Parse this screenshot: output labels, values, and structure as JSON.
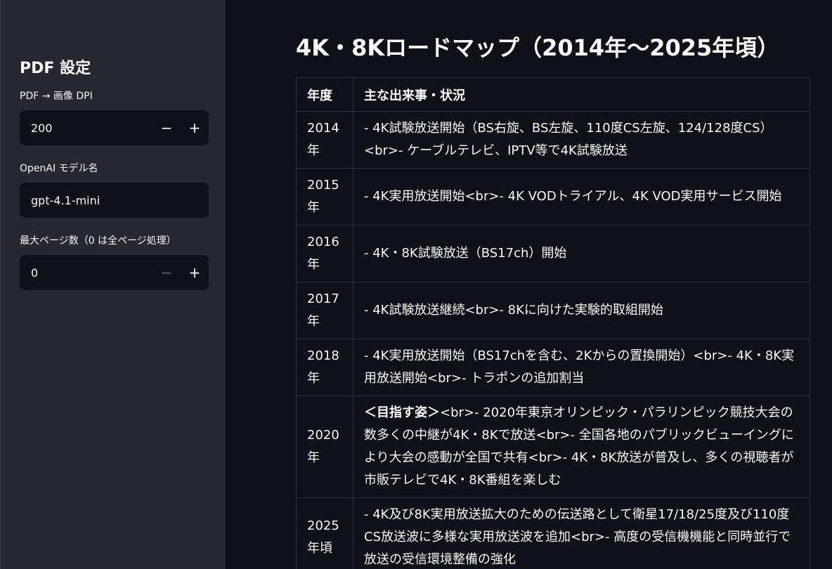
{
  "sidebar": {
    "title": "PDF 設定",
    "dpi": {
      "label": "PDF → 画像 DPI",
      "value": "200",
      "minus": "−",
      "plus": "+"
    },
    "model": {
      "label": "OpenAI モデル名",
      "value": "gpt-4.1-mini"
    },
    "max_pages": {
      "label": "最大ページ数（0 は全ページ処理）",
      "value": "0",
      "minus": "−",
      "plus": "+"
    }
  },
  "main": {
    "title": "4K・8Kロードマップ（2014年〜2025年頃）",
    "table": {
      "headers": [
        "年度",
        "主な出来事・状況"
      ],
      "rows": [
        {
          "year": "2014年",
          "event": "- 4K試験放送開始（BS右旋、BS左旋、110度CS左旋、124/128度CS）<br>- ケーブルテレビ、IPTV等で4K試験放送"
        },
        {
          "year": "2015年",
          "event": "- 4K実用放送開始<br>- 4K VODトライアル、4K VOD実用サービス開始"
        },
        {
          "year": "2016年",
          "event": "- 4K・8K試験放送（BS17ch）開始"
        },
        {
          "year": "2017年",
          "event": "- 4K試験放送継続<br>- 8Kに向けた実験的取組開始"
        },
        {
          "year": "2018年",
          "event": "- 4K実用放送開始（BS17chを含む、2Kからの置換開始）<br>- 4K・8K実用放送開始<br>- トラポンの追加割当"
        },
        {
          "year": "2020年",
          "event_strong": "＜目指す姿＞",
          "event": "<br>- 2020年東京オリンピック・パラリンピック競技大会の数多くの中継が4K・8Kで放送<br>- 全国各地のパブリックビューイングにより大会の感動が全国で共有<br>- 4K・8K放送が普及し、多くの視聴者が市販テレビで4K・8K番組を楽しむ"
        },
        {
          "year": "2025年頃",
          "event": "- 4K及び8K実用放送拡大のための伝送路として衛星17/18/25度及び110度CS放送波に多様な実用放送波を追加<br>- 高度の受信機機能と同時並行で放送の受信環境整備の強化"
        }
      ]
    }
  }
}
